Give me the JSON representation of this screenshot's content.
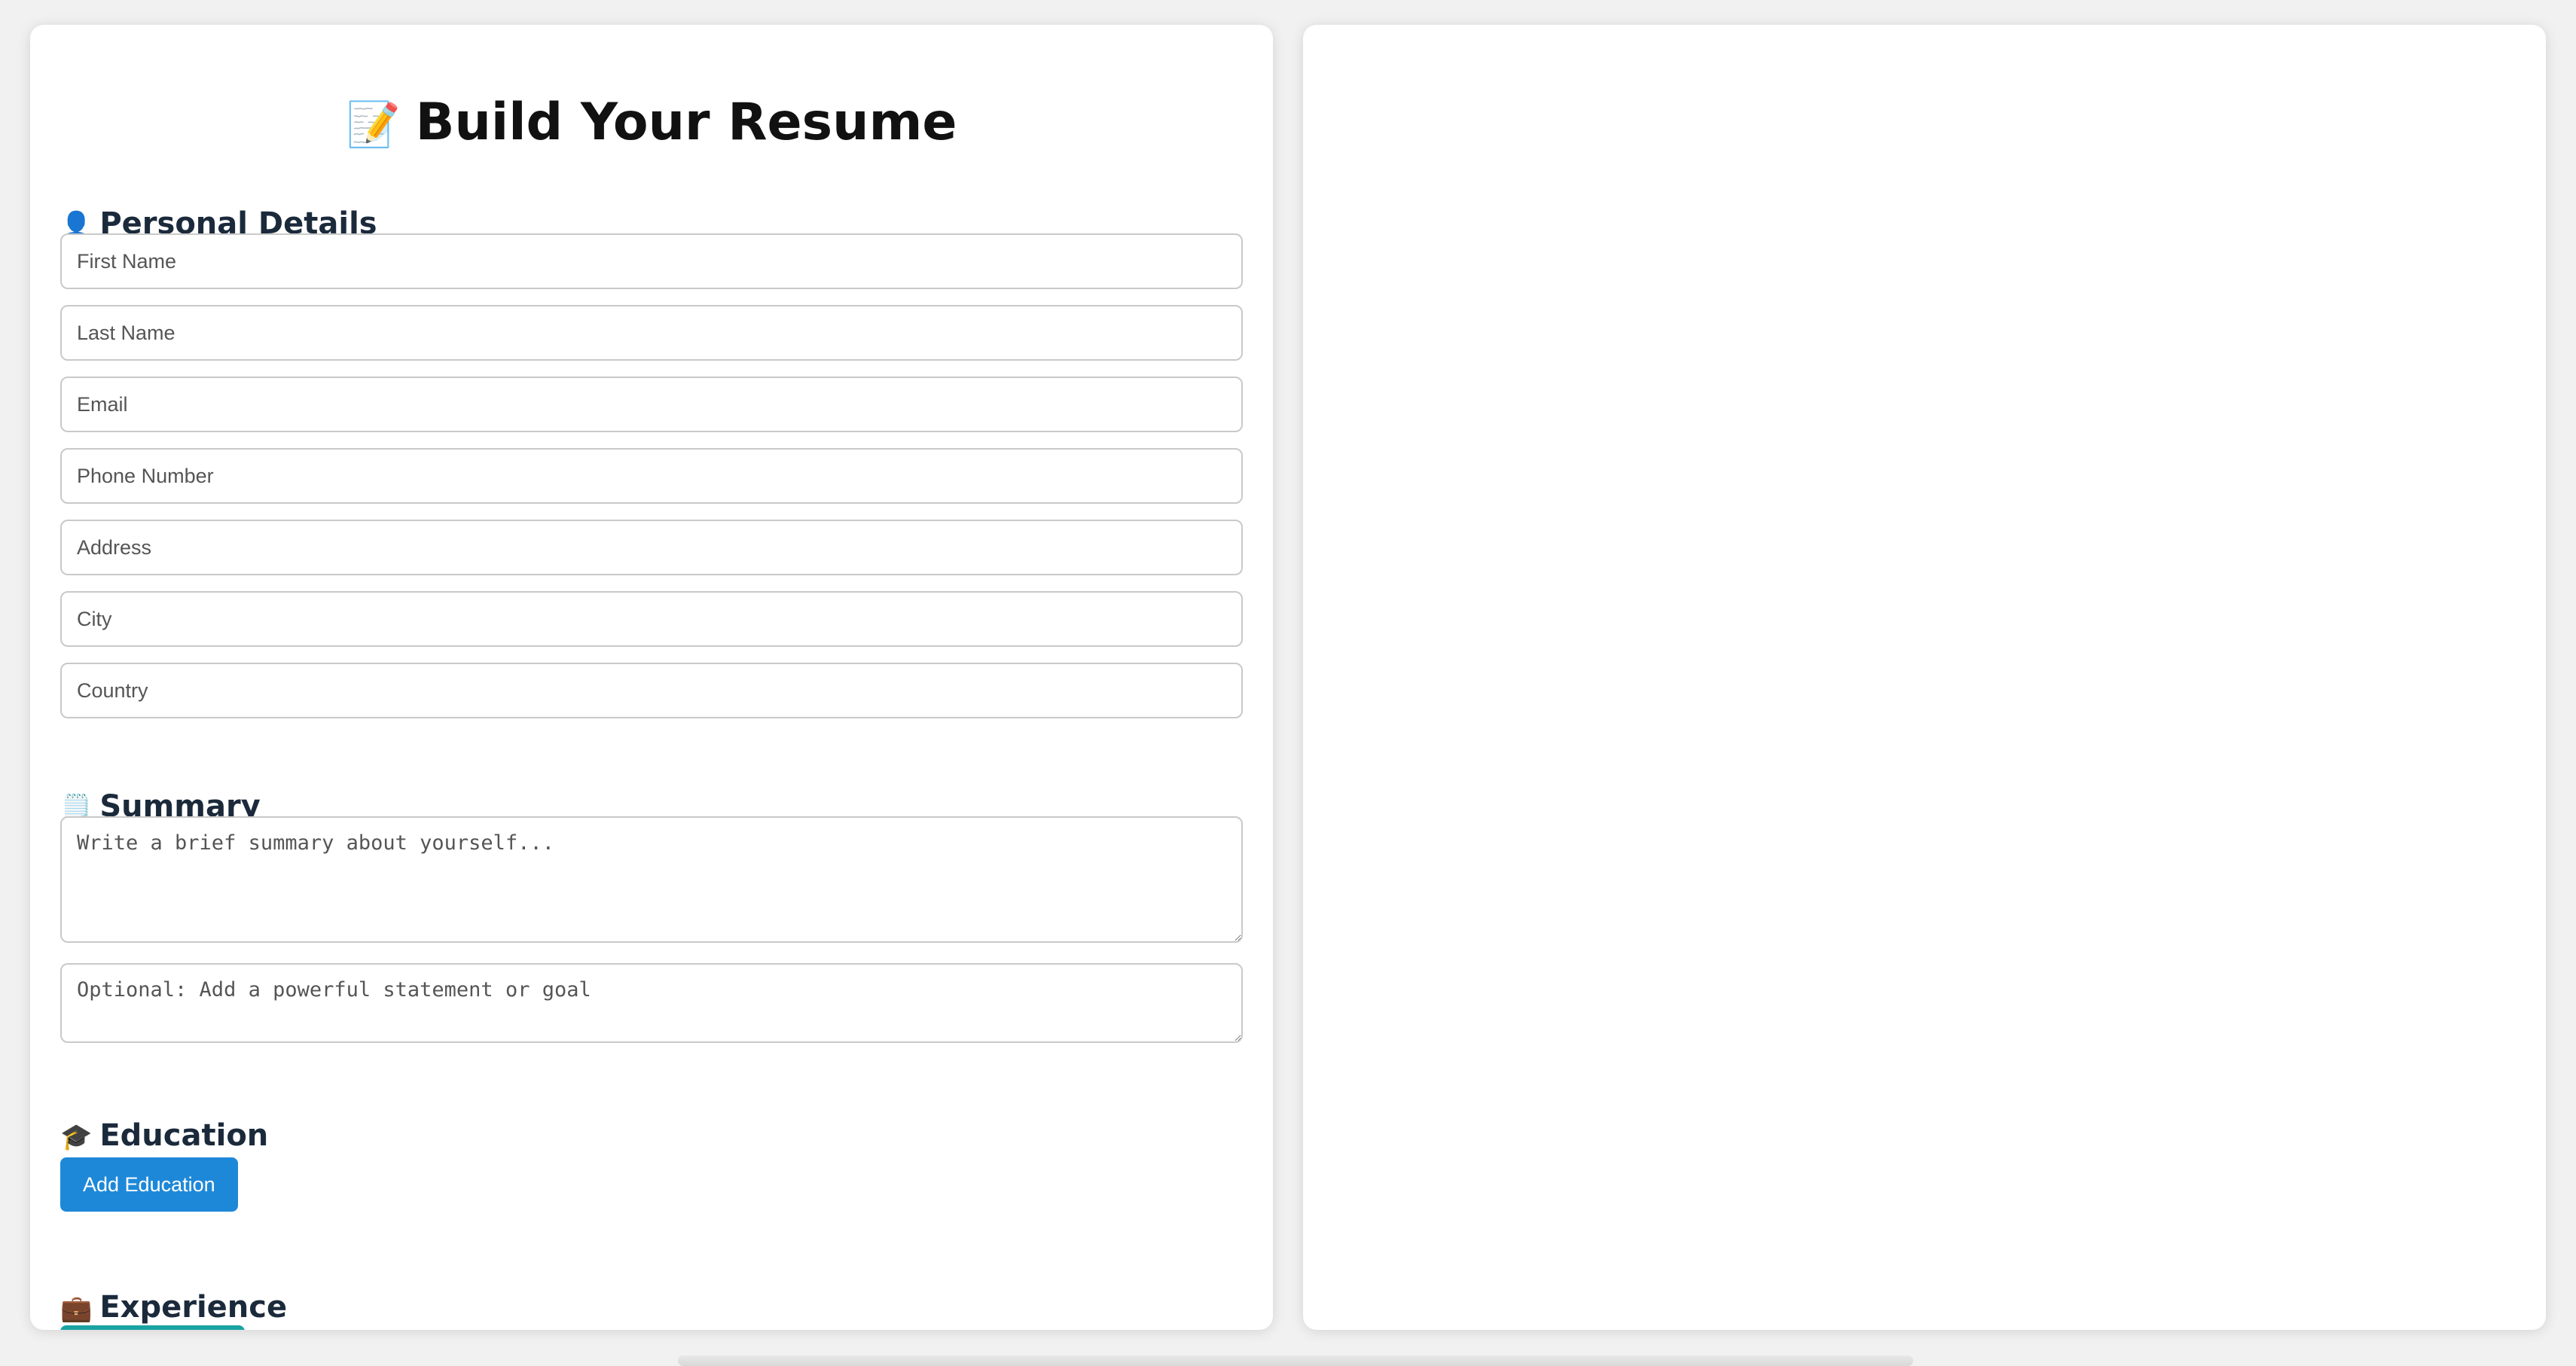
{
  "form": {
    "title": "Build Your Resume",
    "title_icon": "memo-pencil-icon",
    "personal": {
      "heading": "Personal Details",
      "icon": "person-silhouette-icon",
      "fields": {
        "first_name": "First Name",
        "last_name": "Last Name",
        "email": "Email",
        "phone": "Phone Number",
        "address": "Address",
        "city": "City",
        "country": "Country"
      }
    },
    "summary": {
      "heading": "Summary",
      "icon": "notepad-icon",
      "summary_placeholder": "Write a brief summary about yourself...",
      "statement_placeholder": "Optional: Add a powerful statement or goal"
    },
    "education": {
      "heading": "Education",
      "icon": "graduation-cap-icon",
      "add_button": "Add Education"
    },
    "experience": {
      "heading": "Experience",
      "icon": "briefcase-icon"
    }
  },
  "colors": {
    "primary_button": "#1e88d8",
    "heading_text": "#1b2a3b",
    "background": "#f1f1f1",
    "panel": "#ffffff"
  }
}
